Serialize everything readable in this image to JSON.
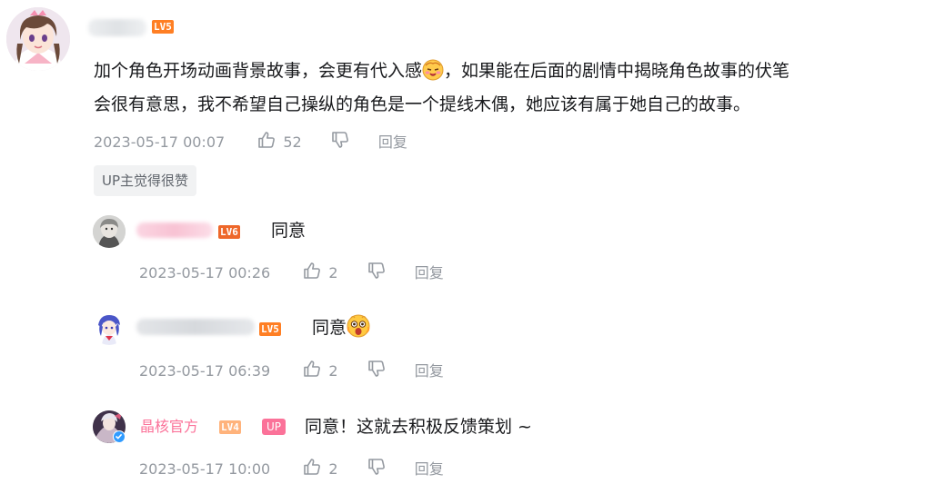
{
  "colors": {
    "lv5": "#ff7f24",
    "lv6": "#ee672a",
    "lv4": "#ffb37c",
    "up_badge": "#fb7299",
    "official_name": "#fb7299",
    "meta_text": "#9499a0"
  },
  "main_comment": {
    "level": "LV5",
    "content_line1": "加个角色开场动画背景故事，会更有代入感",
    "content_line1b": "，如果能在后面的剧情中揭晓角色故事的伏笔",
    "content_line2": "会很有意思，我不希望自己操纵的角色是一个提线木偶，她应该有属于她自己的故事。",
    "time": "2023-05-17 00:07",
    "likes": "52",
    "reply_label": "回复",
    "up_liked_tag": "UP主觉得很赞"
  },
  "replies": [
    {
      "level": "LV6",
      "content": "同意",
      "time": "2023-05-17 00:26",
      "likes": "2",
      "reply_label": "回复"
    },
    {
      "level": "LV5",
      "content": "同意",
      "time": "2023-05-17 06:39",
      "likes": "2",
      "reply_label": "回复"
    },
    {
      "name": "晶核官方",
      "level": "LV4",
      "up_badge": "UP",
      "content": "同意！这就去积极反馈策划 ~",
      "time": "2023-05-17 10:00",
      "likes": "2",
      "reply_label": "回复"
    }
  ]
}
